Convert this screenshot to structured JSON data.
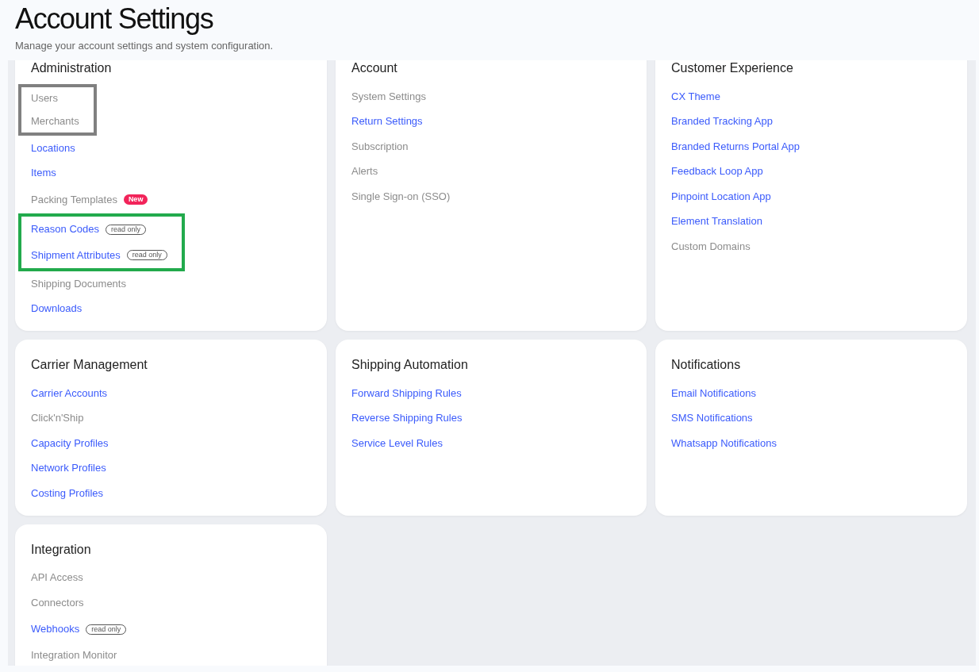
{
  "header": {
    "title": "Account Settings",
    "subtitle": "Manage your account settings and system configuration."
  },
  "sections": [
    {
      "title": "Administration",
      "items": [
        {
          "kind": "frame",
          "color": "#808080",
          "children": [
            {
              "kind": "link",
              "label": "Users",
              "enabled": false
            },
            {
              "kind": "link",
              "label": "Merchants",
              "enabled": false
            }
          ]
        },
        {
          "kind": "link",
          "label": "Locations",
          "enabled": true
        },
        {
          "kind": "link",
          "label": "Items",
          "enabled": true
        },
        {
          "kind": "link",
          "label": "Packing Templates",
          "enabled": false,
          "badge": {
            "kind": "new",
            "text": "New"
          }
        },
        {
          "kind": "frame",
          "color": "#22aa4c",
          "children": [
            {
              "kind": "link",
              "label": "Reason Codes",
              "enabled": true,
              "badge": {
                "kind": "read_only",
                "text": "read only"
              }
            },
            {
              "kind": "link",
              "label": "Shipment Attributes",
              "enabled": true,
              "badge": {
                "kind": "read_only",
                "text": "read only"
              }
            }
          ]
        },
        {
          "kind": "link",
          "label": "Shipping Documents",
          "enabled": false
        },
        {
          "kind": "link",
          "label": "Downloads",
          "enabled": true
        }
      ]
    },
    {
      "title": "Account",
      "items": [
        {
          "kind": "link",
          "label": "System Settings",
          "enabled": false
        },
        {
          "kind": "link",
          "label": "Return Settings",
          "enabled": true
        },
        {
          "kind": "link",
          "label": "Subscription",
          "enabled": false
        },
        {
          "kind": "link",
          "label": "Alerts",
          "enabled": false
        },
        {
          "kind": "link",
          "label": "Single Sign-on (SSO)",
          "enabled": false
        }
      ]
    },
    {
      "title": "Customer Experience",
      "items": [
        {
          "kind": "link",
          "label": "CX Theme",
          "enabled": true
        },
        {
          "kind": "link",
          "label": "Branded Tracking App",
          "enabled": true
        },
        {
          "kind": "link",
          "label": "Branded Returns Portal App",
          "enabled": true
        },
        {
          "kind": "link",
          "label": "Feedback Loop App",
          "enabled": true
        },
        {
          "kind": "link",
          "label": "Pinpoint Location App",
          "enabled": true
        },
        {
          "kind": "link",
          "label": "Element Translation",
          "enabled": true
        },
        {
          "kind": "link",
          "label": "Custom Domains",
          "enabled": false
        }
      ]
    },
    {
      "title": "Carrier Management",
      "items": [
        {
          "kind": "link",
          "label": "Carrier Accounts",
          "enabled": true
        },
        {
          "kind": "link",
          "label": "Click'n'Ship",
          "enabled": false
        },
        {
          "kind": "link",
          "label": "Capacity Profiles",
          "enabled": true
        },
        {
          "kind": "link",
          "label": "Network Profiles",
          "enabled": true
        },
        {
          "kind": "link",
          "label": "Costing Profiles",
          "enabled": true
        }
      ]
    },
    {
      "title": "Shipping Automation",
      "items": [
        {
          "kind": "link",
          "label": "Forward Shipping Rules",
          "enabled": true
        },
        {
          "kind": "link",
          "label": "Reverse Shipping Rules",
          "enabled": true
        },
        {
          "kind": "link",
          "label": "Service Level Rules",
          "enabled": true
        }
      ]
    },
    {
      "title": "Notifications",
      "items": [
        {
          "kind": "link",
          "label": "Email Notifications",
          "enabled": true
        },
        {
          "kind": "link",
          "label": "SMS Notifications",
          "enabled": true
        },
        {
          "kind": "link",
          "label": "Whatsapp Notifications",
          "enabled": true
        }
      ]
    },
    {
      "title": "Integration",
      "items": [
        {
          "kind": "link",
          "label": "API Access",
          "enabled": false
        },
        {
          "kind": "link",
          "label": "Connectors",
          "enabled": false
        },
        {
          "kind": "link",
          "label": "Webhooks",
          "enabled": true,
          "badge": {
            "kind": "read_only",
            "text": "read only"
          }
        },
        {
          "kind": "link",
          "label": "Integration Monitor",
          "enabled": false
        }
      ]
    }
  ]
}
